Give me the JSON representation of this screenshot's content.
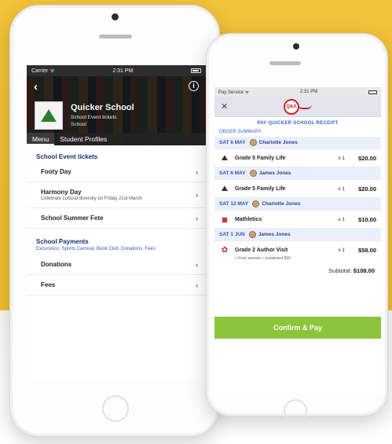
{
  "left_screen": {
    "status": {
      "carrier": "Carrier ᯤ",
      "time": "2:31 PM"
    },
    "school_name": "Quicker School",
    "school_sub1": "School Event tickets",
    "school_sub2": "School",
    "tabs": [
      "Menu",
      "Student Profiles"
    ],
    "sections": [
      {
        "title": "School Event tickets",
        "subtitle": "",
        "items": [
          {
            "label": "Footy Day",
            "desc": ""
          },
          {
            "label": "Harmony Day",
            "desc": "Celebrate cultural diversity on Friday 21st March"
          },
          {
            "label": "School Summer Fete",
            "desc": ""
          }
        ]
      },
      {
        "title": "School Payments",
        "subtitle": "Excursions, Sports Carnival, Book Club, Donations, Fees",
        "items": [
          {
            "label": "Donations",
            "desc": ""
          },
          {
            "label": "Fees",
            "desc": ""
          }
        ]
      }
    ]
  },
  "right_screen": {
    "status": {
      "carrier": "Pay Service ᯤ",
      "time": "2:31 PM"
    },
    "logo_text": "Q&A",
    "banner": "PAY QUICKER SCHOOL RECEIPT",
    "order_summary": "ORDER SUMMARY",
    "groups": [
      {
        "date": "SAT 6 MAY",
        "person": "Charlotte Jones",
        "items": [
          {
            "title": "Grade 5 Family Life",
            "qty": "x 1",
            "price": "$20.00",
            "note": "",
            "note2": ""
          }
        ]
      },
      {
        "date": "SAT 6 MAY",
        "person": "James Jones",
        "items": [
          {
            "title": "Grade 5 Family Life",
            "qty": "x 1",
            "price": "$20.00",
            "note": "",
            "note2": ""
          }
        ]
      },
      {
        "date": "SAT 12 MAY",
        "person": "Charlotte Jones",
        "items": [
          {
            "title": "Mathletics",
            "qty": "x 1",
            "price": "$10.00",
            "note": "",
            "note2": ""
          }
        ]
      },
      {
        "date": "SAT 1 JUN",
        "person": "James Jones",
        "items": [
          {
            "title": "Grade 2 Author Visit",
            "qty": "x 1",
            "price": "$58.00",
            "note": "+ Free amount + instalment $50",
            "note2": ""
          }
        ]
      }
    ],
    "subtotal_label": "Subtotal:",
    "subtotal_value": "$108.00",
    "confirm_label": "Confirm & Pay"
  },
  "colors": {
    "background_yellow": "#f2c23a",
    "confirm_green": "#8cc43c",
    "link_blue": "#3b62c4",
    "header_dark": "#2d2d2d"
  },
  "icons": [
    "back-arrow-icon",
    "info-icon",
    "chevron-right-icon",
    "close-icon",
    "person-avatar-icon",
    "event-logo-icon"
  ]
}
